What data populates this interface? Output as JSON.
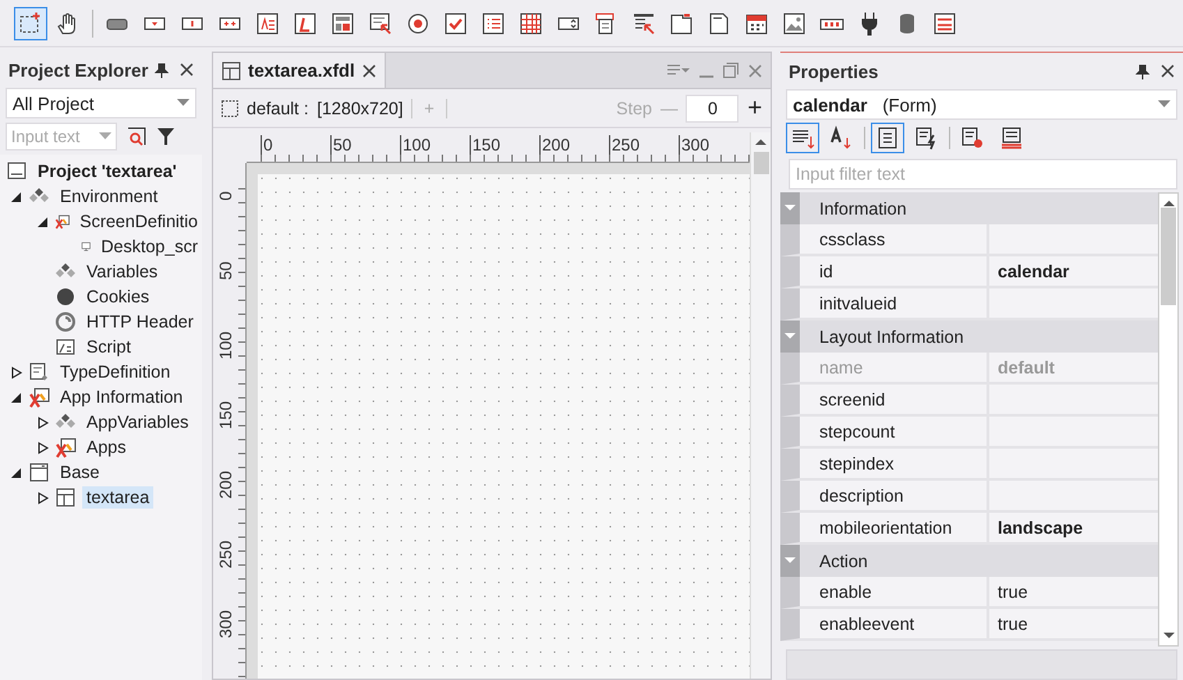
{
  "toolbar": {
    "tools": [
      {
        "selected": true
      },
      {
        "selected": false
      },
      {
        "selected": false
      },
      {
        "selected": false
      },
      {
        "selected": false
      },
      {
        "selected": false
      },
      {
        "selected": false
      },
      {
        "selected": false
      },
      {
        "selected": false
      },
      {
        "selected": false
      },
      {
        "selected": false
      },
      {
        "selected": false
      },
      {
        "selected": false
      },
      {
        "selected": false
      },
      {
        "selected": false
      },
      {
        "selected": false
      },
      {
        "selected": false
      },
      {
        "selected": false
      },
      {
        "selected": false
      },
      {
        "selected": false
      },
      {
        "selected": false
      },
      {
        "selected": false
      },
      {
        "selected": false
      },
      {
        "selected": false
      },
      {
        "selected": false
      }
    ]
  },
  "project_explorer": {
    "title": "Project Explorer",
    "scope": "All Project",
    "search": {
      "placeholder": "Input text"
    },
    "tree": [
      {
        "label": "Project 'textarea'",
        "kind": "project",
        "selected": false,
        "children": [
          {
            "label": "Environment",
            "kind": "variables",
            "expanded": true,
            "selected": false,
            "children": [
              {
                "label": "ScreenDefinitio",
                "kind": "screen",
                "expanded": true,
                "selected": false,
                "children": [
                  {
                    "label": "Desktop_scr",
                    "kind": "monitor",
                    "selected": false
                  }
                ]
              },
              {
                "label": "Variables",
                "kind": "variables",
                "selected": false
              },
              {
                "label": "Cookies",
                "kind": "cookie",
                "selected": false
              },
              {
                "label": "HTTP Header",
                "kind": "http",
                "selected": false
              },
              {
                "label": "Script",
                "kind": "script",
                "selected": false
              }
            ]
          },
          {
            "label": "TypeDefinition",
            "kind": "typedef",
            "expanded": false,
            "selected": false
          },
          {
            "label": "App Information",
            "kind": "screen",
            "expanded": true,
            "selected": false,
            "children": [
              {
                "label": "AppVariables",
                "kind": "variables",
                "expanded": false,
                "selected": false
              },
              {
                "label": "Apps",
                "kind": "screen",
                "expanded": false,
                "selected": false
              }
            ]
          },
          {
            "label": "Base",
            "kind": "base",
            "expanded": true,
            "selected": false,
            "children": [
              {
                "label": "textarea",
                "kind": "form",
                "expanded": false,
                "selected": true
              }
            ]
          }
        ]
      }
    ]
  },
  "editor": {
    "tab": {
      "title": "textarea.xfdl",
      "selected": true
    },
    "layout": {
      "name": "default :",
      "size": "[1280x720]",
      "add": "+",
      "step_label": "Step",
      "step_minus": "—",
      "step_value": "0",
      "step_plus": "+"
    },
    "ruler": {
      "x_labels": [
        "0",
        "50",
        "100",
        "150",
        "200",
        "250",
        "300"
      ],
      "y_labels": [
        "0",
        "50",
        "100",
        "150",
        "200",
        "250",
        "300"
      ]
    }
  },
  "properties": {
    "title": "Properties",
    "object": {
      "name": "calendar",
      "type": "(Form)"
    },
    "tools": [
      {
        "selected": true
      },
      {
        "selected": false
      },
      {
        "selected": true
      },
      {
        "selected": false
      },
      {
        "selected": false
      },
      {
        "selected": false
      }
    ],
    "filter": {
      "placeholder": "Input filter text"
    },
    "groups": [
      {
        "title": "Information",
        "expanded": true,
        "rows": [
          {
            "name": "cssclass",
            "value": "",
            "disabled": false,
            "modified": false
          },
          {
            "name": "id",
            "value": "calendar",
            "disabled": false,
            "modified": true
          },
          {
            "name": "initvalueid",
            "value": "",
            "disabled": false,
            "modified": false
          }
        ]
      },
      {
        "title": "Layout Information",
        "expanded": true,
        "rows": [
          {
            "name": "name",
            "value": "default",
            "disabled": true,
            "modified": true
          },
          {
            "name": "screenid",
            "value": "",
            "disabled": false,
            "modified": false
          },
          {
            "name": "stepcount",
            "value": "",
            "disabled": false,
            "modified": false
          },
          {
            "name": "stepindex",
            "value": "",
            "disabled": false,
            "modified": false
          },
          {
            "name": "description",
            "value": "",
            "disabled": false,
            "modified": false
          },
          {
            "name": "mobileorientation",
            "value": "landscape",
            "disabled": false,
            "modified": true
          }
        ]
      },
      {
        "title": "Action",
        "expanded": true,
        "rows": [
          {
            "name": "enable",
            "value": "true",
            "disabled": false,
            "modified": false
          },
          {
            "name": "enableevent",
            "value": "true",
            "disabled": false,
            "modified": false
          }
        ]
      }
    ]
  }
}
